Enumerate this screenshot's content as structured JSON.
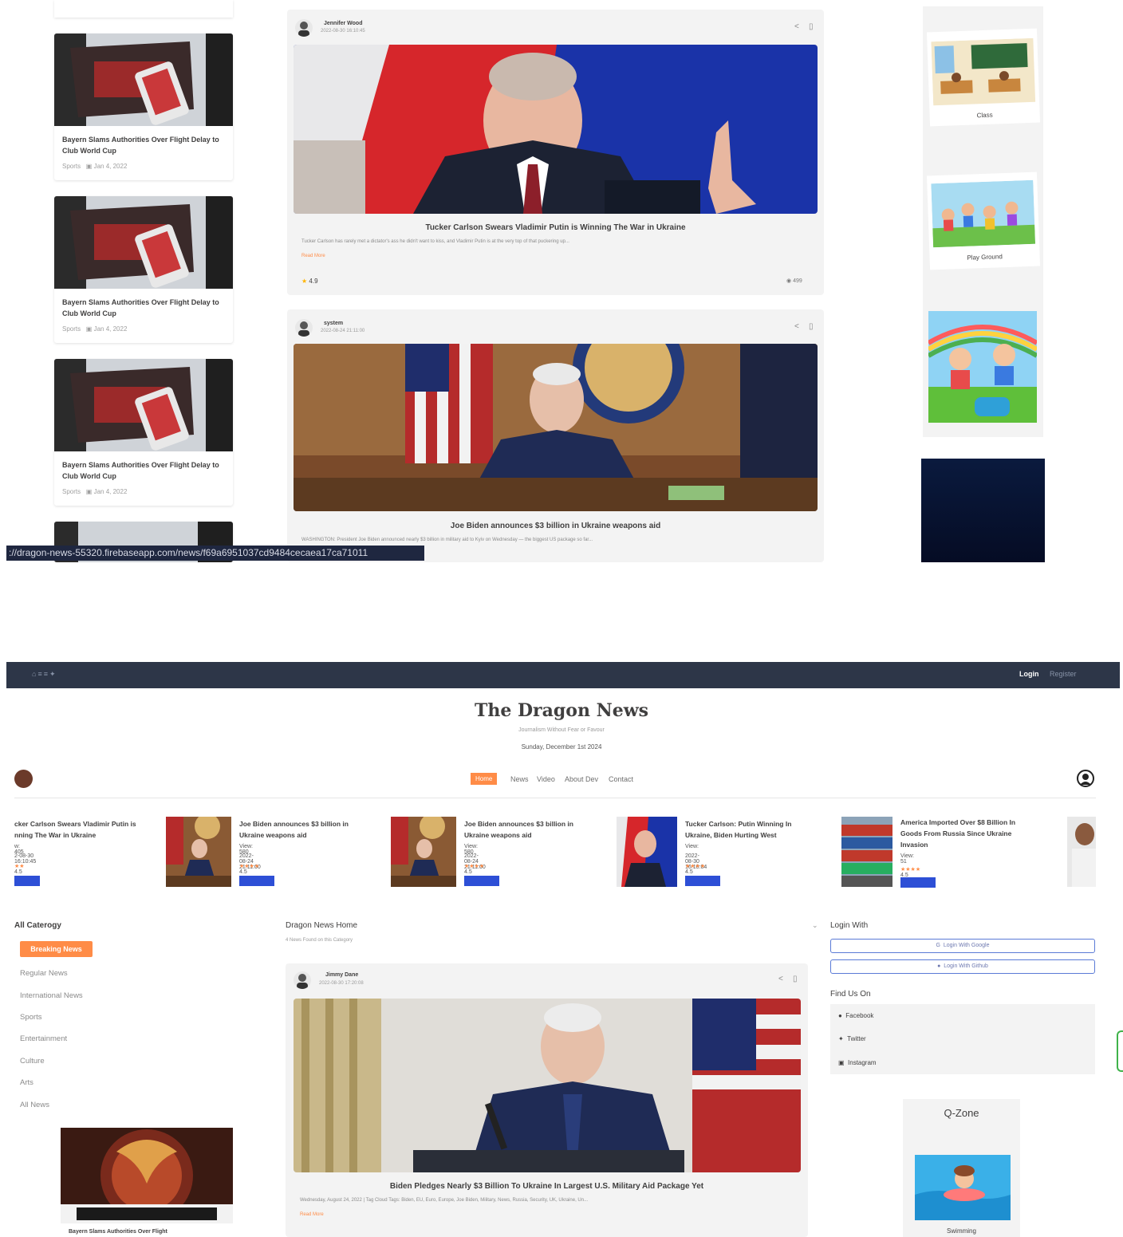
{
  "top_screenshot": {
    "left_cards": [
      {
        "title": "Bayern Slams Authorities Over Flight Delay to Club World Cup",
        "category": "Sports",
        "date": "Jan 4, 2022"
      },
      {
        "title": "Bayern Slams Authorities Over Flight Delay to Club World Cup",
        "category": "Sports",
        "date": "Jan 4, 2022"
      },
      {
        "title": "Bayern Slams Authorities Over Flight Delay to Club World Cup",
        "category": "Sports",
        "date": "Jan 4, 2022"
      }
    ],
    "news_cards": [
      {
        "author": "Jennifer Wood",
        "date": "2022-08-30 16:10:45",
        "title": "Tucker Carlson Swears Vladimir Putin is Winning The War in Ukraine",
        "excerpt": "Tucker Carlson has rarely met a dictator's ass he didn't want to kiss, and Vladimir Putin is at the very top of that puckering up...",
        "read_more": "Read More",
        "rating": "4.9",
        "views": "499"
      },
      {
        "author": "system",
        "date": "2022-08-24 21:11:00",
        "title": "Joe Biden announces $3 billion in Ukraine weapons aid",
        "excerpt": "WASHINGTON: President Joe Biden announced nearly $3 billion in military aid to Kyiv on Wednesday — the biggest US package so far..."
      }
    ],
    "qzone": [
      {
        "label": "Class"
      },
      {
        "label": "Play Ground"
      }
    ],
    "status_url": "://dragon-news-55320.firebaseapp.com/news/f69a6951037cd9484cecaea17ca71011"
  },
  "header": {
    "login": "Login",
    "register": "Register",
    "logo": "The Dragon News",
    "tagline": "Journalism Without Fear or Favour",
    "date": "Sunday, December 1st 2024"
  },
  "nav": {
    "home": "Home",
    "news": "News",
    "video": "Video",
    "about": "About Dev",
    "contact": "Contact"
  },
  "ticker": [
    {
      "title": "cker Carlson Swears Vladimir Putin is nning The War in Ukraine",
      "views": "w: 405",
      "date": "2-08-30 16:10:45",
      "rating": "4.5"
    },
    {
      "title": "Joe Biden announces $3 billion in Ukraine weapons aid",
      "views": "View: 580",
      "date": "2022-08-24 21:11:00",
      "rating": "4.5"
    },
    {
      "title": "Joe Biden announces $3 billion in Ukraine weapons aid",
      "views": "View: 580",
      "date": "2022-08-24 21:11:00",
      "rating": "4.5"
    },
    {
      "title": "Tucker Carlson: Putin Winning In Ukraine, Biden Hurting West",
      "views": "View:",
      "date": "2022-08-30 16:10:04",
      "rating": "4.5"
    },
    {
      "title": "America Imported Over $8 Billion In Goods From Russia Since Ukraine Invasion",
      "views": "View: 51",
      "date": "",
      "rating": "4.5"
    }
  ],
  "sidebar": {
    "heading": "All Caterogy",
    "items": [
      "Breaking News",
      "Regular News",
      "International News",
      "Sports",
      "Entertainment",
      "Culture",
      "Arts",
      "All News"
    ],
    "ad_caption": "Bayern Slams Authorities Over Flight"
  },
  "main": {
    "heading": "Dragon News Home",
    "subheading": "4 News Found on this Category",
    "card": {
      "author": "Jimmy Dane",
      "date": "2022-08-30 17:20:08",
      "title": "Biden Pledges Nearly $3 Billion To Ukraine In Largest U.S. Military Aid Package Yet",
      "excerpt": "Wednesday, August 24, 2022 | Tag Cloud Tags: Biden, EU, Euro, Europe, Joe Biden, Military, News, Russia, Security, UK, Ukraine, Un...",
      "read_more": "Read More"
    }
  },
  "right": {
    "login_heading": "Login With",
    "google": "Login With Google",
    "github": "Login With Github",
    "find_heading": "Find Us On",
    "facebook": "Facebook",
    "twitter": "Twitter",
    "instagram": "Instagram",
    "qzone_title": "Q-Zone",
    "qzone_item": "Swimming"
  },
  "colors": {
    "accent": "#ff8c47",
    "topbar": "#2d3648",
    "button_blue": "#2d4fd6"
  }
}
